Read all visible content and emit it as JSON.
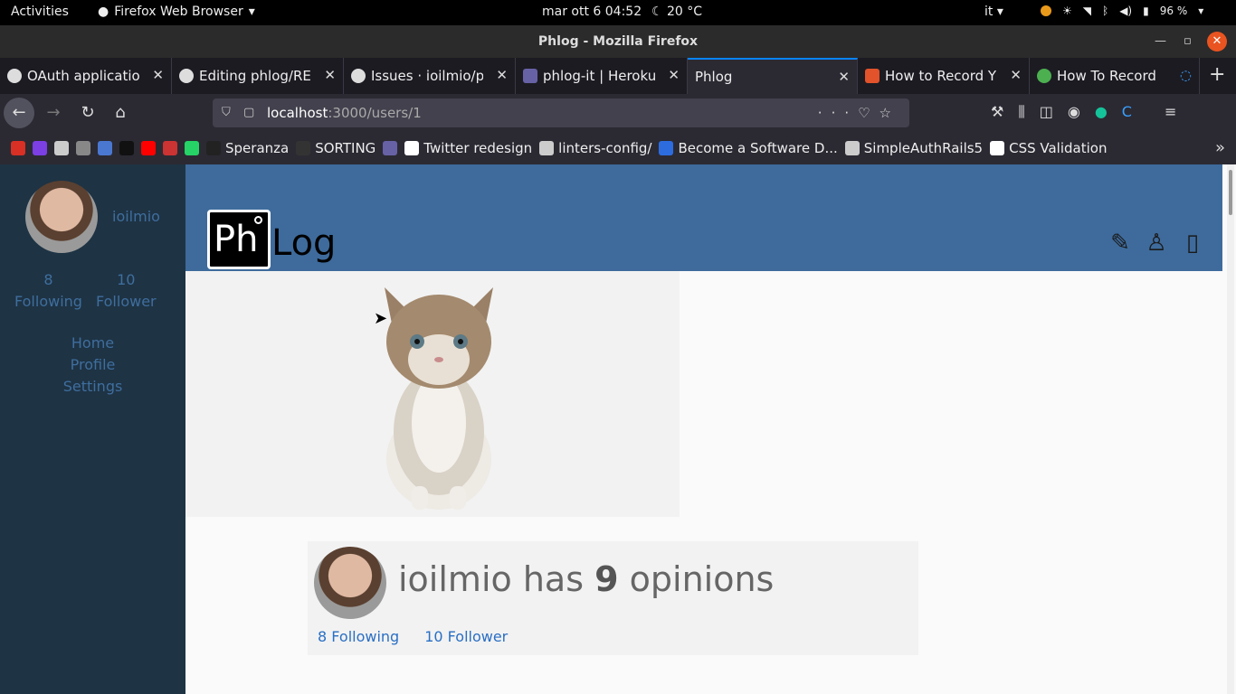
{
  "system": {
    "activities": "Activities",
    "app_menu": "Firefox Web Browser",
    "clock": "mar ott 6  04:52",
    "weather": "20 °C",
    "lang": "it",
    "battery": "96 %"
  },
  "window": {
    "title": "Phlog - Mozilla Firefox"
  },
  "tabs": [
    {
      "label": "OAuth applicatio",
      "favicon_color": "#ffffff"
    },
    {
      "label": "Editing phlog/RE",
      "favicon_color": "#ffffff"
    },
    {
      "label": "Issues · ioilmio/p",
      "favicon_color": "#ffffff"
    },
    {
      "label": "phlog-it | Heroku",
      "favicon_color": "#6762a6"
    },
    {
      "label": "Phlog",
      "favicon_color": ""
    },
    {
      "label": "How to Record Y",
      "favicon_color": "#e2522b"
    },
    {
      "label": "How To Record Y",
      "favicon_color": "#4caf50"
    }
  ],
  "urlbar": {
    "host": "localhost",
    "rest": ":3000/users/1"
  },
  "bookmarks": [
    {
      "label": "",
      "color": "#d93025"
    },
    {
      "label": "",
      "color": "#7b3fe4"
    },
    {
      "label": "",
      "color": "#cccccc"
    },
    {
      "label": "",
      "color": "#888888"
    },
    {
      "label": "",
      "color": "#4a78d1"
    },
    {
      "label": "",
      "color": "#111111"
    },
    {
      "label": "",
      "color": "#ff0000"
    },
    {
      "label": "",
      "color": "#cc3333"
    },
    {
      "label": "",
      "color": "#25d366"
    },
    {
      "label": "Speranza",
      "color": "#222222"
    },
    {
      "label": "SORTING",
      "color": "#333333"
    },
    {
      "label": "",
      "color": "#6762a6"
    },
    {
      "label": "Twitter redesign",
      "color": "#ffffff"
    },
    {
      "label": "linters-config/",
      "color": "#cccccc"
    },
    {
      "label": "Become a Software D...",
      "color": "#2d6cdf"
    },
    {
      "label": "SimpleAuthRails5",
      "color": "#cccccc"
    },
    {
      "label": "CSS Validation",
      "color": "#ffffff"
    }
  ],
  "sidebar": {
    "username": "ioilmio",
    "following_count": "8",
    "following_label": "Following",
    "follower_count": "10",
    "follower_label": "Follower",
    "nav": [
      "Home",
      "Profile",
      "Settings"
    ]
  },
  "header": {
    "logo_mark": "Ph",
    "logo_text": "Log"
  },
  "profile": {
    "username": "ioilmio",
    "has": "has",
    "count": "9",
    "noun": "opinions",
    "following_link": "8 Following",
    "follower_link": "10 Follower"
  }
}
